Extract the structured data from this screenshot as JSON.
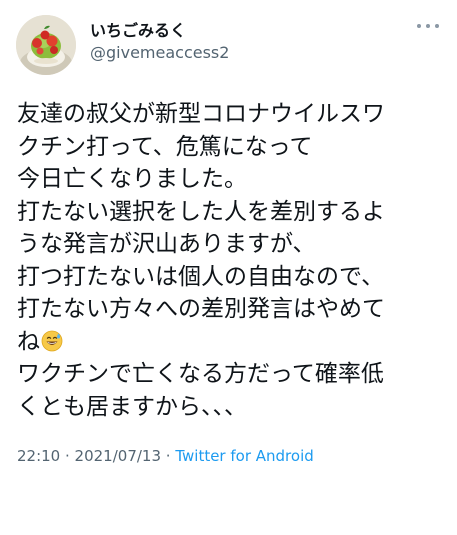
{
  "user": {
    "display_name": "いちごみるく",
    "handle": "@givemeaccess2"
  },
  "icons": {
    "more": "more-horizontal-icon",
    "emoji": "grinning-face-with-sweat-emoji"
  },
  "tweet": {
    "lines": [
      "友達の叔父が新型コロナウイルスワ",
      "クチン打って、危篤になって",
      "今日亡くなりました。",
      "打たない選択をした人を差別するよ",
      "うな発言が沢山ありますが、",
      "打つ打たないは個人の自由なので、",
      "打たない方々への差別発言はやめて",
      "ね",
      "ワクチンで亡くなる方だって確率低",
      "くとも居ますから、、、"
    ]
  },
  "meta": {
    "time": "22:10",
    "separator1": " · ",
    "date": "2021/07/13",
    "separator2": " · ",
    "source": "Twitter for Android"
  },
  "colors": {
    "text": "#0f1419",
    "secondary": "#536471",
    "link": "#1d9bf0"
  }
}
